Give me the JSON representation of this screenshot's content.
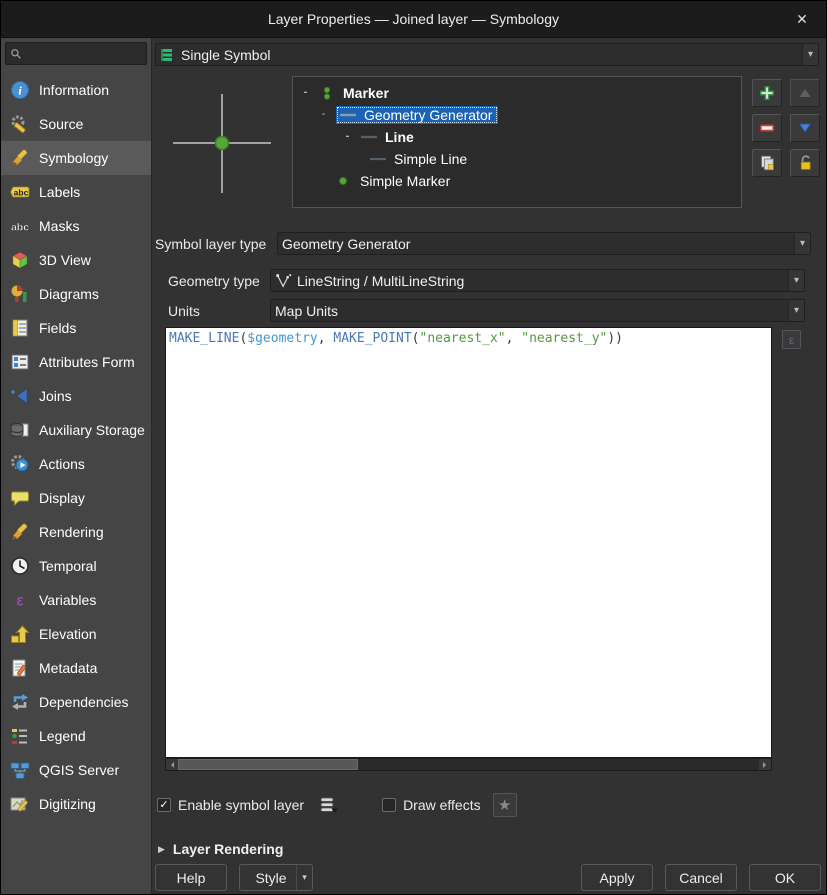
{
  "window": {
    "title": "Layer Properties — Joined layer — Symbology",
    "close_glyph": "✕"
  },
  "sidebar": {
    "search": {
      "placeholder": ""
    },
    "items": [
      {
        "label": "Information",
        "icon": "information-icon"
      },
      {
        "label": "Source",
        "icon": "source-icon"
      },
      {
        "label": "Symbology",
        "icon": "symbology-icon",
        "selected": true
      },
      {
        "label": "Labels",
        "icon": "labels-icon"
      },
      {
        "label": "Masks",
        "icon": "masks-icon"
      },
      {
        "label": "3D View",
        "icon": "3d-view-icon"
      },
      {
        "label": "Diagrams",
        "icon": "diagrams-icon"
      },
      {
        "label": "Fields",
        "icon": "fields-icon"
      },
      {
        "label": "Attributes Form",
        "icon": "attributes-form-icon"
      },
      {
        "label": "Joins",
        "icon": "joins-icon"
      },
      {
        "label": "Auxiliary Storage",
        "icon": "auxiliary-storage-icon"
      },
      {
        "label": "Actions",
        "icon": "actions-icon"
      },
      {
        "label": "Display",
        "icon": "display-icon"
      },
      {
        "label": "Rendering",
        "icon": "rendering-icon"
      },
      {
        "label": "Temporal",
        "icon": "temporal-icon"
      },
      {
        "label": "Variables",
        "icon": "variables-icon"
      },
      {
        "label": "Elevation",
        "icon": "elevation-icon"
      },
      {
        "label": "Metadata",
        "icon": "metadata-icon"
      },
      {
        "label": "Dependencies",
        "icon": "dependencies-icon"
      },
      {
        "label": "Legend",
        "icon": "legend-icon"
      },
      {
        "label": "QGIS Server",
        "icon": "qgis-server-icon"
      },
      {
        "label": "Digitizing",
        "icon": "digitizing-icon"
      }
    ]
  },
  "renderer": {
    "value": "Single Symbol",
    "icon": "single-symbol-icon"
  },
  "symbol_tree": {
    "items": [
      {
        "label": "Marker",
        "expander": "-",
        "icon": "marker-symbol-icon"
      },
      {
        "label": "Geometry Generator",
        "expander": "-",
        "icon": "line-symbol-icon",
        "selected": true
      },
      {
        "label": "Line",
        "expander": "-",
        "icon": "line-symbol-icon"
      },
      {
        "label": "Simple Line",
        "icon": "line-symbol-icon"
      },
      {
        "label": "Simple Marker",
        "icon": "marker-dot-icon"
      }
    ]
  },
  "fields": {
    "symbol_layer_type": {
      "label": "Symbol layer type",
      "value": "Geometry Generator"
    },
    "geometry_type": {
      "label": "Geometry type",
      "value": "LineString / MultiLineString",
      "icon": "linestring-icon"
    },
    "units": {
      "label": "Units",
      "value": "Map Units"
    }
  },
  "expression": {
    "full_text": "MAKE_LINE($geometry, MAKE_POINT(\"nearest_x\", \"nearest_y\"))",
    "tokens": [
      {
        "text": "MAKE_LINE",
        "type": "function"
      },
      {
        "text": "(",
        "type": "plain"
      },
      {
        "text": "$geometry",
        "type": "variable"
      },
      {
        "text": ", ",
        "type": "plain"
      },
      {
        "text": "MAKE_POINT",
        "type": "function"
      },
      {
        "text": "(",
        "type": "plain"
      },
      {
        "text": "\"nearest_x\"",
        "type": "field"
      },
      {
        "text": ", ",
        "type": "plain"
      },
      {
        "text": "\"nearest_y\"",
        "type": "field"
      },
      {
        "text": "))",
        "type": "plain"
      }
    ],
    "palette": {
      "function": "#4a76b8",
      "variable": "#4596ce",
      "field": "#55993f",
      "plain": "#3c3c3c"
    },
    "builder_glyph": "ε"
  },
  "options": {
    "enable_symbol_layer": {
      "label": "Enable symbol layer",
      "checked": true,
      "check_glyph": "✓"
    },
    "draw_effects": {
      "label": "Draw effects",
      "checked": false,
      "check_glyph": ""
    },
    "effects_star_glyph": "★"
  },
  "layer_rendering": {
    "label": "Layer Rendering",
    "collapsed_glyph": "▶"
  },
  "footer": {
    "help": "Help",
    "style": "Style",
    "style_arrow": "▾",
    "apply": "Apply",
    "cancel": "Cancel",
    "ok": "OK"
  },
  "colors": {
    "selection_blue": "#1d63b5",
    "marker_green": "#57a639",
    "titlebar_bg": "#1c1c1c",
    "sidebar_bg": "#454545",
    "dialog_bg": "#323232"
  }
}
